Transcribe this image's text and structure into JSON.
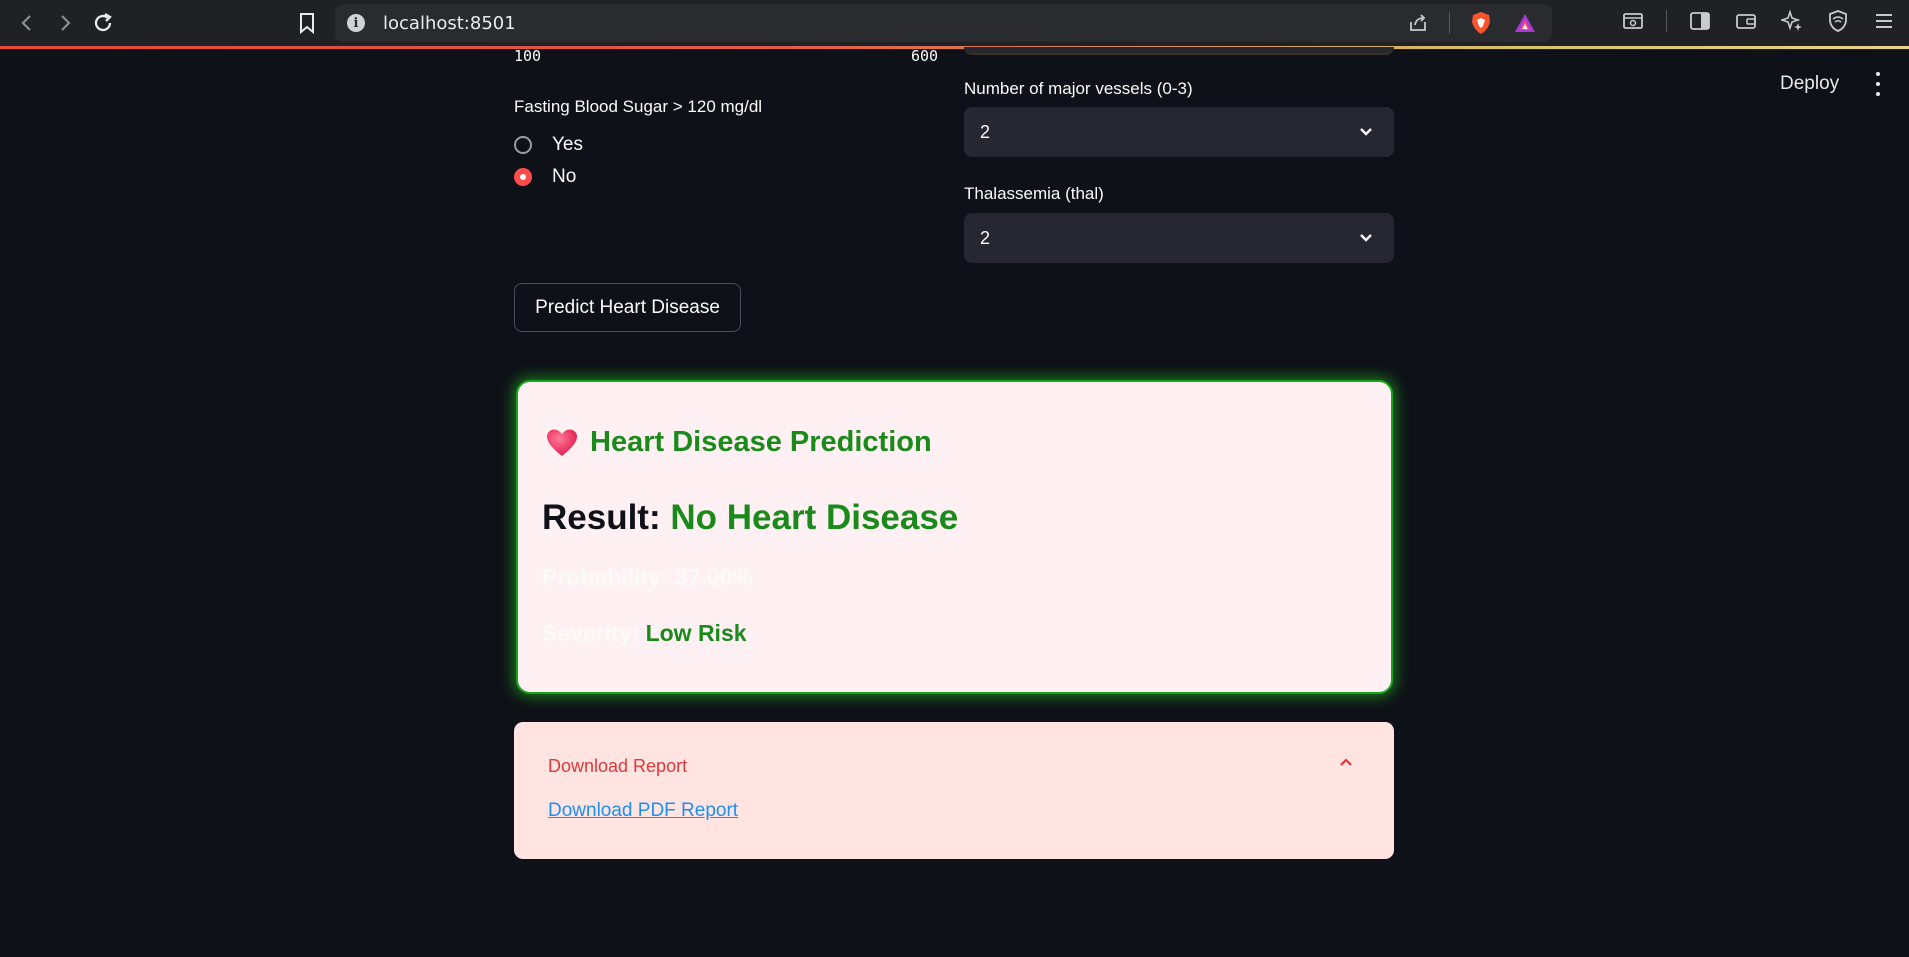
{
  "browser": {
    "url": "localhost:8501"
  },
  "header": {
    "deploy_label": "Deploy"
  },
  "slider": {
    "min_label": "100",
    "max_label": "600"
  },
  "fasting_blood_sugar": {
    "label": "Fasting Blood Sugar > 120 mg/dl",
    "options": [
      "Yes",
      "No"
    ],
    "selected": "No"
  },
  "major_vessels": {
    "label": "Number of major vessels (0-3)",
    "value": "2"
  },
  "thalassemia": {
    "label": "Thalassemia (thal)",
    "value": "2"
  },
  "predict_button_label": "Predict Heart Disease",
  "prediction_card": {
    "title": "Heart Disease Prediction",
    "result_label": "Result:",
    "result_value": "No Heart Disease",
    "probability_label": "Probability:",
    "probability_value": "37.00%",
    "severity_label": "Severity:",
    "severity_value": "Low Risk"
  },
  "download_expander": {
    "title": "Download Report",
    "link_label": "Download PDF Report"
  },
  "colors": {
    "background": "#0e1117",
    "accent_red": "#ff4b4b",
    "success_green": "#1a8a1a",
    "card_bg": "#fff0f3",
    "expander_bg": "#ffe4e2",
    "link_blue": "#1f8ef1"
  }
}
